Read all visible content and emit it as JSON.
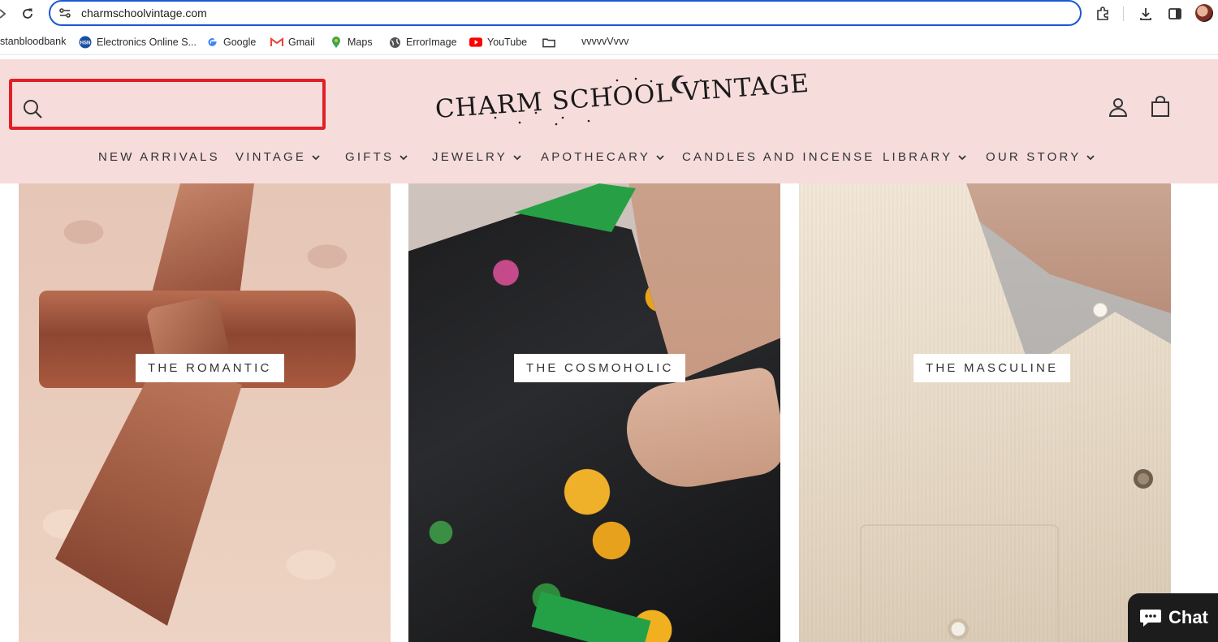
{
  "browser": {
    "url": "charmschoolvintage.com",
    "bookmarks": [
      {
        "label": "stanbloodbank",
        "icon": "none"
      },
      {
        "label": "Electronics Online S...",
        "icon": "hsn-icon"
      },
      {
        "label": "Google",
        "icon": "google-icon"
      },
      {
        "label": "Gmail",
        "icon": "gmail-icon"
      },
      {
        "label": "Maps",
        "icon": "maps-icon"
      },
      {
        "label": "ErrorImage",
        "icon": "globe-icon"
      },
      {
        "label": "YouTube",
        "icon": "youtube-icon"
      },
      {
        "label": "",
        "icon": "folder-icon"
      },
      {
        "label": "vvvvvVvvv",
        "icon": "none"
      }
    ]
  },
  "header": {
    "logo_text": "CHARM SCHOOL VINTAGE",
    "search_highlight_color": "#e01f26",
    "background_color": "#f7dcdc"
  },
  "nav": {
    "items": [
      {
        "label": "NEW ARRIVALS",
        "has_dropdown": false
      },
      {
        "label": "VINTAGE",
        "has_dropdown": true
      },
      {
        "label": "GIFTS",
        "has_dropdown": true
      },
      {
        "label": "JEWELRY",
        "has_dropdown": true
      },
      {
        "label": "APOTHECARY",
        "has_dropdown": true
      },
      {
        "label": "CANDLES AND INCENSE",
        "has_dropdown": false
      },
      {
        "label": "LIBRARY",
        "has_dropdown": true
      },
      {
        "label": "OUR STORY",
        "has_dropdown": true
      }
    ]
  },
  "collections": [
    {
      "label": "THE ROMANTIC"
    },
    {
      "label": "THE COSMOHOLIC"
    },
    {
      "label": "THE MASCULINE"
    }
  ],
  "chat": {
    "label": "Chat"
  }
}
